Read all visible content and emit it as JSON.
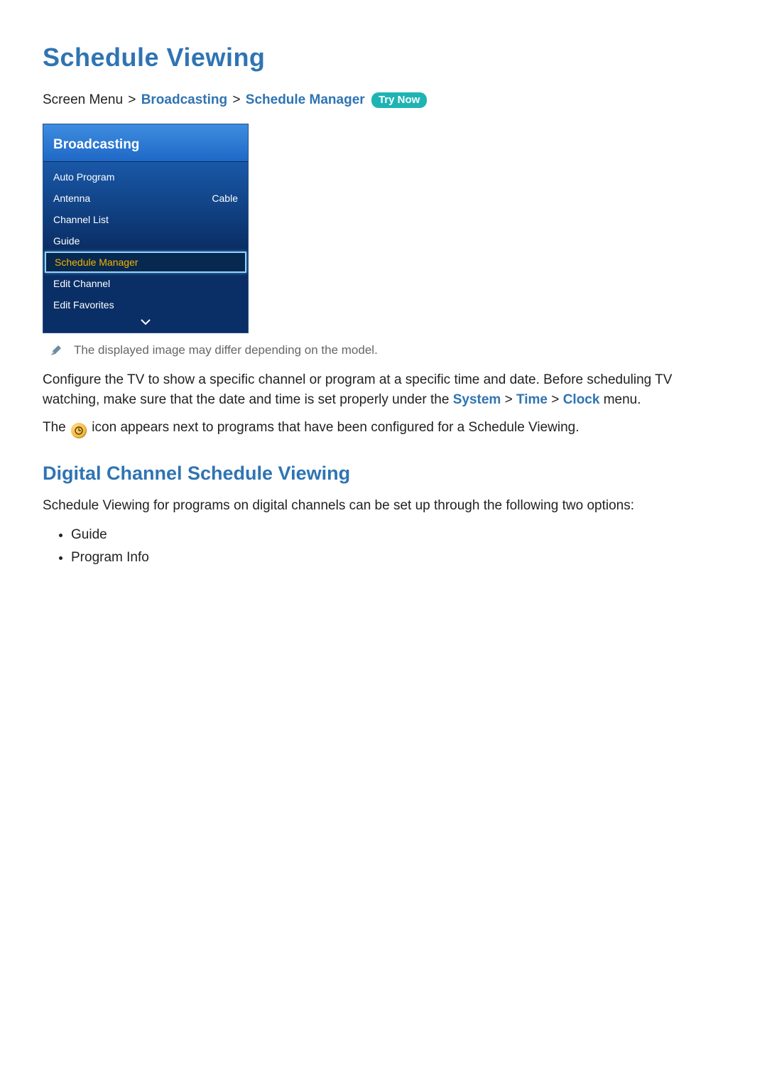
{
  "title": "Schedule Viewing",
  "breadcrumb": {
    "prefix": "Screen Menu",
    "sep": ">",
    "part1": "Broadcasting",
    "part2": "Schedule Manager",
    "trynow": "Try Now"
  },
  "menu": {
    "header": "Broadcasting",
    "items": [
      {
        "label": "Auto Program",
        "value": ""
      },
      {
        "label": "Antenna",
        "value": "Cable"
      },
      {
        "label": "Channel List",
        "value": ""
      },
      {
        "label": "Guide",
        "value": ""
      },
      {
        "label": "Schedule Manager",
        "value": "",
        "selected": true
      },
      {
        "label": "Edit Channel",
        "value": ""
      },
      {
        "label": "Edit Favorites",
        "value": ""
      }
    ]
  },
  "note": "The displayed image may differ depending on the model.",
  "para1_a": "Configure the TV to show a specific channel or program at a specific time and date. Before scheduling TV watching, make sure that the date and time is set properly under the ",
  "para1_sys": "System",
  "para1_time": "Time",
  "para1_clock": "Clock",
  "para1_b": " menu.",
  "para2_a": "The ",
  "para2_b": " icon appears next to programs that have been configured for a Schedule Viewing.",
  "section2": "Digital Channel Schedule Viewing",
  "para3": "Schedule Viewing for programs on digital channels can be set up through the following two options:",
  "bullets": [
    "Guide",
    "Program Info"
  ]
}
